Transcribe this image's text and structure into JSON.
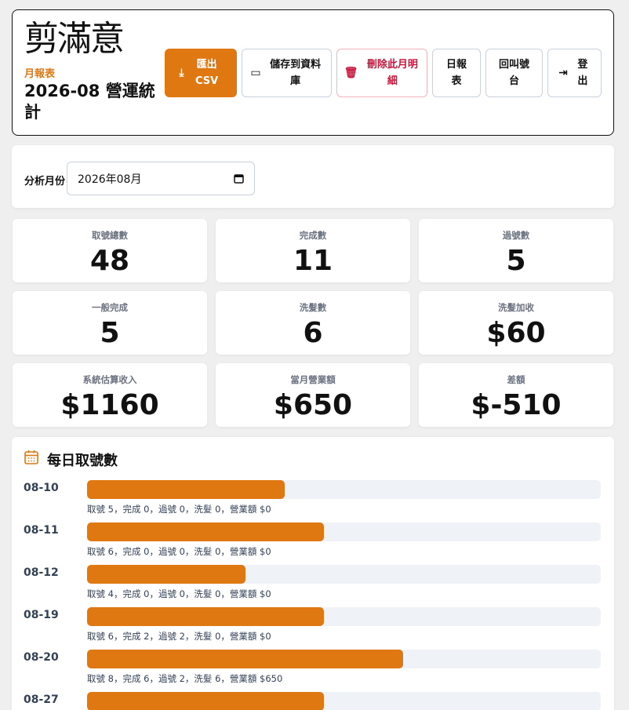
{
  "brand": {
    "logo_text": "剪滿意",
    "subtitle": "月報表",
    "title": "2026-08 營運統計"
  },
  "toolbar": [
    {
      "id": "export-csv-button",
      "label": "匯出 CSV",
      "icon": "download-icon",
      "icon_char": "⤓",
      "variant": "primary"
    },
    {
      "id": "save-to-db-button",
      "label": "儲存到資料庫",
      "icon": "archive-icon",
      "icon_char": "▭",
      "variant": "default"
    },
    {
      "id": "delete-month-button",
      "label": "刪除此月明細",
      "icon": "trash-icon",
      "icon_char": "🗑",
      "variant": "danger"
    },
    {
      "id": "daily-report-button",
      "label": "日報表",
      "icon": "",
      "icon_char": "",
      "variant": "default"
    },
    {
      "id": "call-desk-button",
      "label": "回叫號台",
      "icon": "",
      "icon_char": "",
      "variant": "default"
    },
    {
      "id": "logout-button",
      "label": "登出",
      "icon": "logout-icon",
      "icon_char": "⇥",
      "variant": "default"
    }
  ],
  "filter": {
    "label": "分析月份",
    "value": "2026年08月"
  },
  "stats": [
    {
      "label": "取號總數",
      "value": "48"
    },
    {
      "label": "完成數",
      "value": "11"
    },
    {
      "label": "過號數",
      "value": "5"
    },
    {
      "label": "一般完成",
      "value": "5"
    },
    {
      "label": "洗髮數",
      "value": "6"
    },
    {
      "label": "洗髮加收",
      "value": "$60"
    },
    {
      "label": "系統估算收入",
      "value": "$1160"
    },
    {
      "label": "當月營業額",
      "value": "$650"
    },
    {
      "label": "差額",
      "value": "$-510"
    }
  ],
  "daily": {
    "title": "每日取號數",
    "scale_max": 13,
    "colors": {
      "bar": "#e07811",
      "track": "#eff3f8"
    },
    "rows": [
      {
        "date": "08-10",
        "count": 5,
        "detail": "取號 5，完成 0，過號 0，洗髮 0，營業額 $0"
      },
      {
        "date": "08-11",
        "count": 6,
        "detail": "取號 6，完成 0，過號 0，洗髮 0，營業額 $0"
      },
      {
        "date": "08-12",
        "count": 4,
        "detail": "取號 4，完成 0，過號 0，洗髮 0，營業額 $0"
      },
      {
        "date": "08-19",
        "count": 6,
        "detail": "取號 6，完成 2，過號 2，洗髮 0，營業額 $0"
      },
      {
        "date": "08-20",
        "count": 8,
        "detail": "取號 8，完成 6，過號 2，洗髮 6，營業額 $650"
      },
      {
        "date": "08-27",
        "count": 6,
        "detail": ""
      }
    ]
  }
}
